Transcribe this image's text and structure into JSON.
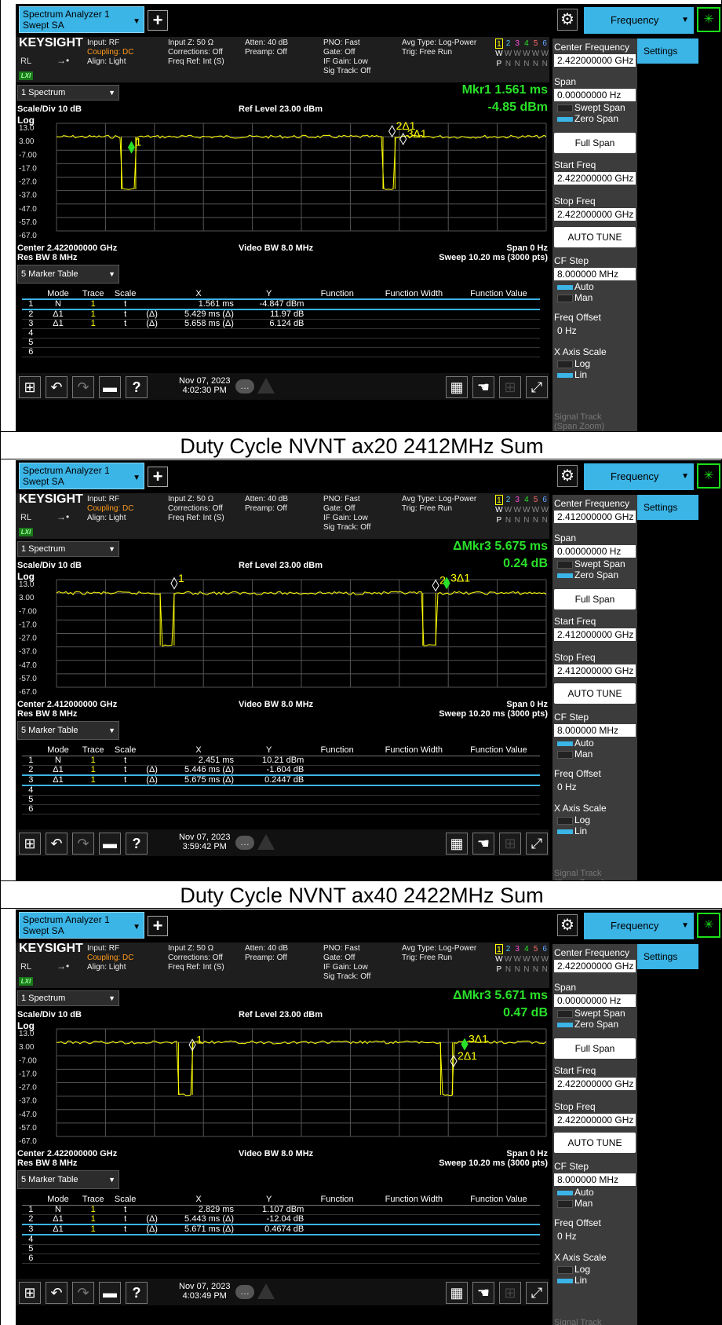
{
  "captions": [
    "Duty Cycle NVNT ax20 2412MHz Sum",
    "Duty Cycle NVNT ax40 2422MHz Sum"
  ],
  "common": {
    "app_title_line1": "Spectrum Analyzer 1",
    "app_title_line2": "Swept SA",
    "plus_label": "+",
    "gear_label": "⚙",
    "menu_label": "Frequency",
    "brand": "KEYSIGHT",
    "rl": "RL",
    "lxi": "LXI",
    "input": "Input: RF",
    "coupling": "Coupling: DC",
    "align": "Align: Light",
    "input_z": "Input Z: 50 Ω",
    "corrections": "Corrections: Off",
    "freq_ref": "Freq Ref: Int (S)",
    "atten": "Atten: 40 dB",
    "preamp": "Preamp: Off",
    "pno": "PNO: Fast",
    "gate": "Gate: Off",
    "if_gain": "IF Gain: Low",
    "sig_track": "Sig Track: Off",
    "avg_type": "Avg Type: Log-Power",
    "trig": "Trig: Free Run",
    "trace_nums": [
      "1",
      "2",
      "3",
      "4",
      "5",
      "6"
    ],
    "trace_types": [
      "W",
      "W",
      "W",
      "W",
      "W",
      "W"
    ],
    "trace_dets": [
      "P",
      "N",
      "N",
      "N",
      "N",
      "N"
    ],
    "spectrum_sel": "1 Spectrum",
    "scale_div": "Scale/Div 10 dB",
    "ref_level": "Ref Level 23.00 dBm",
    "log_label": "Log",
    "y_ticks": [
      "13.0",
      "3.00",
      "-7.00",
      "-17.0",
      "-27.0",
      "-37.0",
      "-47.0",
      "-57.0",
      "-67.0"
    ],
    "video_bw": "Video BW 8.0 MHz",
    "span_zero": "Span 0 Hz",
    "res_bw": "Res BW 8 MHz",
    "sweep": "Sweep 10.20 ms (3000 pts)",
    "marker_table_sel": "5 Marker Table",
    "table_headers": [
      "",
      "Mode",
      "Trace",
      "Scale",
      "",
      "X",
      "Y",
      "Function",
      "Function Width",
      "Function Value"
    ],
    "sidebar": {
      "settings": "Settings",
      "center_freq_label": "Center Frequency",
      "span_label": "Span",
      "span_value": "0.00000000 Hz",
      "swept_span": "Swept Span",
      "zero_span": "Zero Span",
      "full_span": "Full Span",
      "start_freq_label": "Start Freq",
      "stop_freq_label": "Stop Freq",
      "auto_tune": "AUTO TUNE",
      "cf_step_label": "CF Step",
      "cf_step_value": "8.000000 MHz",
      "auto": "Auto",
      "man": "Man",
      "freq_offset_label": "Freq Offset",
      "freq_offset_value": "0 Hz",
      "x_axis_label": "X Axis Scale",
      "log": "Log",
      "lin": "Lin",
      "signal_track": "Signal Track",
      "span_zoom": "(Span Zoom)"
    }
  },
  "panels": [
    {
      "freq": "2.422000000 GHz",
      "center": "Center 2.422000000 GHz",
      "mkr_line1": "Mkr1  1.561 ms",
      "mkr_line2": "-4.85 dBm",
      "date": "Nov 07, 2023",
      "time": "4:02:30 PM",
      "selected_row": 0,
      "rows": [
        {
          "n": "1",
          "mode": "N",
          "trace": "1",
          "scale": "t",
          "d": "",
          "x": "1.561 ms",
          "y": "-4.847 dBm"
        },
        {
          "n": "2",
          "mode": "Δ1",
          "trace": "1",
          "scale": "t",
          "d": "(Δ)",
          "x": "5.429 ms (Δ)",
          "y": "11.97 dB"
        },
        {
          "n": "3",
          "mode": "Δ1",
          "trace": "1",
          "scale": "t",
          "d": "(Δ)",
          "x": "5.658 ms (Δ)",
          "y": "6.124 dB"
        },
        {
          "n": "4",
          "mode": "",
          "trace": "",
          "scale": "",
          "d": "",
          "x": "",
          "y": ""
        },
        {
          "n": "5",
          "mode": "",
          "trace": "",
          "scale": "",
          "d": "",
          "x": "",
          "y": ""
        },
        {
          "n": "6",
          "mode": "",
          "trace": "",
          "scale": "",
          "d": "",
          "x": "",
          "y": ""
        }
      ],
      "trace_data": {
        "units": "ms",
        "dips": [
          [
            1.35,
            1.65
          ],
          [
            6.8,
            7.05
          ]
        ],
        "high_dbm": 3.0,
        "low_dbm": -36.0
      },
      "markers": [
        {
          "label": "1",
          "x_ms": 1.561,
          "level_dbm": -4.85,
          "active": true
        },
        {
          "label": "2Δ1",
          "x_ms": 6.99,
          "level_dbm": 7.1,
          "active": false
        },
        {
          "label": "3Δ1",
          "x_ms": 7.22,
          "level_dbm": 1.3,
          "active": false
        }
      ]
    },
    {
      "freq": "2.412000000 GHz",
      "center": "Center 2.412000000 GHz",
      "mkr_line1": "ΔMkr3  5.675 ms",
      "mkr_line2": "0.24 dB",
      "date": "Nov 07, 2023",
      "time": "3:59:42 PM",
      "selected_row": 2,
      "rows": [
        {
          "n": "1",
          "mode": "N",
          "trace": "1",
          "scale": "t",
          "d": "",
          "x": "2.451 ms",
          "y": "10.21 dBm"
        },
        {
          "n": "2",
          "mode": "Δ1",
          "trace": "1",
          "scale": "t",
          "d": "(Δ)",
          "x": "5.446 ms (Δ)",
          "y": "-1.604 dB"
        },
        {
          "n": "3",
          "mode": "Δ1",
          "trace": "1",
          "scale": "t",
          "d": "(Δ)",
          "x": "5.675 ms (Δ)",
          "y": "0.2447 dB"
        },
        {
          "n": "4",
          "mode": "",
          "trace": "",
          "scale": "",
          "d": "",
          "x": "",
          "y": ""
        },
        {
          "n": "5",
          "mode": "",
          "trace": "",
          "scale": "",
          "d": "",
          "x": "",
          "y": ""
        },
        {
          "n": "6",
          "mode": "",
          "trace": "",
          "scale": "",
          "d": "",
          "x": "",
          "y": ""
        }
      ],
      "trace_data": {
        "units": "ms",
        "dips": [
          [
            2.16,
            2.45
          ],
          [
            7.63,
            7.9
          ]
        ],
        "high_dbm": 3.0,
        "low_dbm": -36.0
      },
      "markers": [
        {
          "label": "1",
          "x_ms": 2.451,
          "level_dbm": 10.21,
          "active": false
        },
        {
          "label": "2",
          "x_ms": 7.897,
          "level_dbm": 8.6,
          "active": false
        },
        {
          "label": "3Δ1",
          "x_ms": 8.126,
          "level_dbm": 10.45,
          "active": true
        }
      ]
    },
    {
      "freq": "2.422000000 GHz",
      "center": "Center 2.422000000 GHz",
      "mkr_line1": "ΔMkr3  5.671 ms",
      "mkr_line2": "0.47 dB",
      "date": "Nov 07, 2023",
      "time": "4:03:49 PM",
      "selected_row": 2,
      "rows": [
        {
          "n": "1",
          "mode": "N",
          "trace": "1",
          "scale": "t",
          "d": "",
          "x": "2.829 ms",
          "y": "1.107 dBm"
        },
        {
          "n": "2",
          "mode": "Δ1",
          "trace": "1",
          "scale": "t",
          "d": "(Δ)",
          "x": "5.443 ms (Δ)",
          "y": "-12.04 dB"
        },
        {
          "n": "3",
          "mode": "Δ1",
          "trace": "1",
          "scale": "t",
          "d": "(Δ)",
          "x": "5.671 ms (Δ)",
          "y": "0.4674 dB"
        },
        {
          "n": "4",
          "mode": "",
          "trace": "",
          "scale": "",
          "d": "",
          "x": "",
          "y": ""
        },
        {
          "n": "5",
          "mode": "",
          "trace": "",
          "scale": "",
          "d": "",
          "x": "",
          "y": ""
        },
        {
          "n": "6",
          "mode": "",
          "trace": "",
          "scale": "",
          "d": "",
          "x": "",
          "y": ""
        }
      ],
      "trace_data": {
        "units": "ms",
        "dips": [
          [
            2.54,
            2.83
          ],
          [
            8.0,
            8.25
          ]
        ],
        "high_dbm": 3.0,
        "low_dbm": -36.0
      },
      "markers": [
        {
          "label": "1",
          "x_ms": 2.829,
          "level_dbm": 1.107,
          "active": false
        },
        {
          "label": "2Δ1",
          "x_ms": 8.272,
          "level_dbm": -10.93,
          "active": false
        },
        {
          "label": "3Δ1",
          "x_ms": 8.5,
          "level_dbm": 1.57,
          "active": true
        }
      ]
    }
  ]
}
